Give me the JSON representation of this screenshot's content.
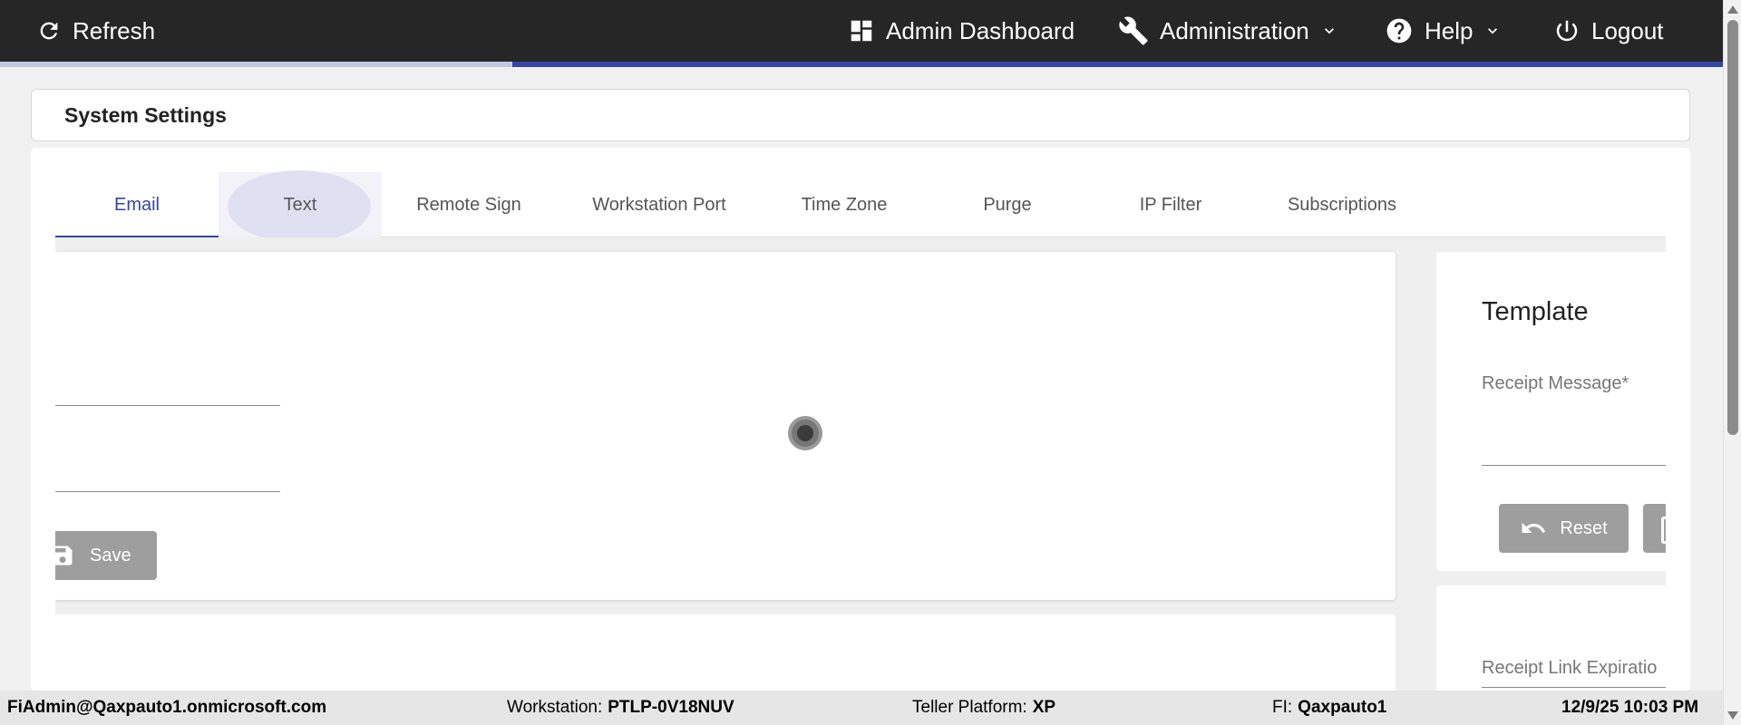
{
  "topbar": {
    "refresh_label": "Refresh",
    "admin_dashboard_label": "Admin Dashboard",
    "administration_label": "Administration",
    "help_label": "Help",
    "logout_label": "Logout"
  },
  "page": {
    "title": "System Settings"
  },
  "tabs": [
    {
      "label": "Email"
    },
    {
      "label": "Text"
    },
    {
      "label": "Remote Sign"
    },
    {
      "label": "Workstation Port"
    },
    {
      "label": "Time Zone"
    },
    {
      "label": "Purge"
    },
    {
      "label": "IP Filter"
    },
    {
      "label": "Subscriptions"
    }
  ],
  "left_panel": {
    "save_label": "Save"
  },
  "right_panel": {
    "template_title": "Template",
    "receipt_message_label": "Receipt Message",
    "required_marker": "*",
    "reset_label": "Reset",
    "receipt_link_expiration_label": "Receipt Link Expiratio"
  },
  "statusbar": {
    "user": "FiAdmin@Qaxpauto1.onmicrosoft.com",
    "workstation_label": "Workstation:",
    "workstation_value": "PTLP-0V18NUV",
    "teller_platform_label": "Teller Platform:",
    "teller_platform_value": "XP",
    "fi_label": "FI:",
    "fi_value": "Qaxpauto1",
    "datetime": "12/9/25 10:03 PM"
  },
  "colors": {
    "accent": "#3545a8",
    "topbar_bg": "#262626",
    "button_disabled": "#9e9e9e"
  },
  "icons": [
    "refresh-icon",
    "dashboard-icon",
    "wrench-icon",
    "chevron-down-icon",
    "help-icon",
    "power-icon",
    "save-icon",
    "undo-icon"
  ]
}
